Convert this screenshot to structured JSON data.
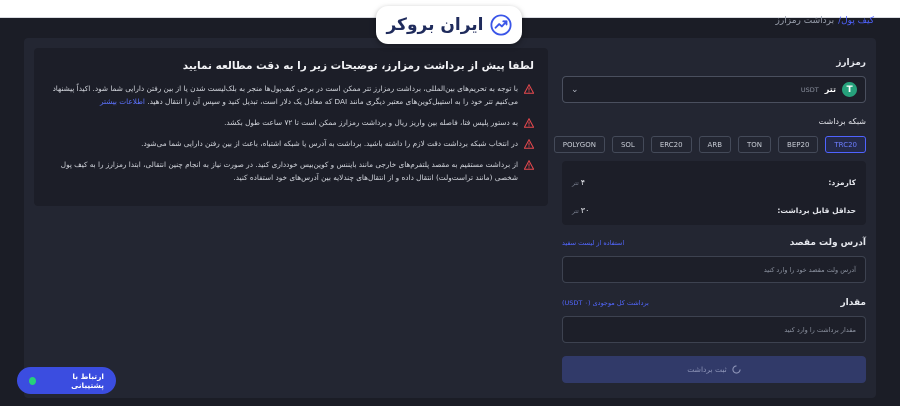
{
  "brand": {
    "logo_text": "ایران بروکر"
  },
  "breadcrumb": {
    "parent": "کیف پول/",
    "current": "برداشت رمزارز"
  },
  "info": {
    "title": "لطفا پیش از برداشت رمزارز، توضیحات زیر را به دقت مطالعه نمایید",
    "warnings": [
      {
        "text": "با توجه به تحریم‌های بین‌المللی، برداشت رمزارز تتر ممکن است در برخی کیف‌پول‌ها منجر به بلک‌لیست شدن یا از بین رفتن دارایی شما شود. اکیداً پیشنهاد می‌کنیم تتر خود را به استیبل‌کوین‌های معتبر دیگری مانند DAI که معادل یک دلار است، تبدیل کنید و سپس آن را انتقال دهید.",
        "link": "اطلاعات بیشتر"
      },
      {
        "text": "به دستور پلیس فتا، فاصله بین واریز ریال و برداشت رمزارز ممکن است تا ۷۲ ساعت طول بکشد."
      },
      {
        "text": "در انتخاب شبکه برداشت دقت لازم را داشته باشید. برداشت به آدرس یا شبکه اشتباه، باعث از بین رفتن دارایی شما می‌شود."
      },
      {
        "text": "از برداشت مستقیم به مقصد پلتفرم‌های خارجی مانند بایننس و کوین‌بیس خودداری کنید. در صورت نیاز به انجام چنین انتقالی، ابتدا رمزارز را به کیف پول شخصی (مانند تراست‌ولت) انتقال داده و از انتقال‌های چندلایه بین آدرس‌های خود استفاده کنید."
      }
    ]
  },
  "form": {
    "currency_label": "رمزارز",
    "currency": {
      "name": "تتر",
      "code": "USDT"
    },
    "network_label": "شبکه برداشت",
    "networks": [
      "TRC20",
      "BEP20",
      "TON",
      "ARB",
      "ERC20",
      "SOL",
      "POLYGON"
    ],
    "active_network": "TRC20",
    "fee_label": "کارمزد:",
    "fee_value": "۴",
    "fee_unit": "تتر",
    "min_label": "حداقل قابل برداشت:",
    "min_value": "۳۰",
    "min_unit": "تتر",
    "address_label": "آدرس ولت مقصد",
    "address_link": "استفاده از لیست سفید",
    "address_placeholder": "آدرس ولت مقصد خود را وارد کنید",
    "amount_label": "مقدار",
    "amount_link": "برداشت کل موجودی (۰ USDT)",
    "amount_placeholder": "مقدار برداشت را وارد کنید",
    "submit_label": "ثبت برداشت"
  },
  "support": {
    "label": "ارتباط با پشتیبانی"
  },
  "colors": {
    "accent": "#4f63ff",
    "background": "#1b1d26",
    "warning": "#e5484d",
    "tether": "#26a17b",
    "online": "#26d07c"
  }
}
